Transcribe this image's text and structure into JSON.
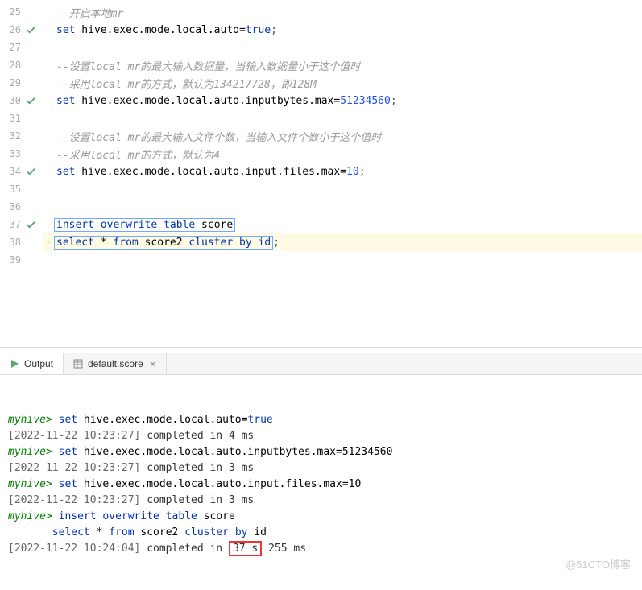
{
  "editor": {
    "lines": [
      {
        "n": 25,
        "mark": false,
        "fold": "",
        "segs": [
          [
            "cm",
            "--开启本地mr"
          ]
        ]
      },
      {
        "n": 26,
        "mark": true,
        "fold": "",
        "segs": [
          [
            "kw",
            "set"
          ],
          [
            "str",
            " hive.exec.mode.local.auto="
          ],
          [
            "kw",
            "true"
          ],
          [
            "punc",
            ";"
          ]
        ]
      },
      {
        "n": 27,
        "mark": false,
        "fold": "",
        "segs": []
      },
      {
        "n": 28,
        "mark": false,
        "fold": "",
        "segs": [
          [
            "cm",
            "--设置local mr的最大输入数据量，当输入数据量小于这个值时"
          ]
        ]
      },
      {
        "n": 29,
        "mark": false,
        "fold": "",
        "segs": [
          [
            "cm",
            "--采用local mr的方式，默认为134217728，即128M"
          ]
        ]
      },
      {
        "n": 30,
        "mark": true,
        "fold": "",
        "segs": [
          [
            "kw",
            "set"
          ],
          [
            "str",
            " hive.exec.mode.local.auto.inputbytes.max="
          ],
          [
            "num",
            "51234560"
          ],
          [
            "punc",
            ";"
          ]
        ]
      },
      {
        "n": 31,
        "mark": false,
        "fold": "",
        "segs": []
      },
      {
        "n": 32,
        "mark": false,
        "fold": "",
        "segs": [
          [
            "cm",
            "--设置local mr的最大输入文件个数，当输入文件个数小于这个值时"
          ]
        ]
      },
      {
        "n": 33,
        "mark": false,
        "fold": "",
        "segs": [
          [
            "cm",
            "--采用local mr的方式，默认为4"
          ]
        ]
      },
      {
        "n": 34,
        "mark": true,
        "fold": "",
        "segs": [
          [
            "kw",
            "set"
          ],
          [
            "str",
            " hive.exec.mode.local.auto.input.files.max="
          ],
          [
            "num",
            "10"
          ],
          [
            "punc",
            ";"
          ]
        ]
      },
      {
        "n": 35,
        "mark": false,
        "fold": "",
        "segs": []
      },
      {
        "n": 36,
        "mark": false,
        "fold": "",
        "segs": []
      },
      {
        "n": 37,
        "mark": true,
        "fold": "-",
        "box": true,
        "segs": [
          [
            "kw",
            "insert"
          ],
          [
            "str",
            " "
          ],
          [
            "kw",
            "overwrite"
          ],
          [
            "str",
            " "
          ],
          [
            "kw",
            "table"
          ],
          [
            "str",
            " score"
          ]
        ]
      },
      {
        "n": 38,
        "mark": false,
        "fold": "-",
        "box": true,
        "hl": true,
        "segs": [
          [
            "kw",
            "select"
          ],
          [
            "str",
            " * "
          ],
          [
            "kw",
            "from"
          ],
          [
            "str",
            " score2 "
          ],
          [
            "kw",
            "cluster"
          ],
          [
            "str",
            " "
          ],
          [
            "kw",
            "by"
          ],
          [
            "str",
            " "
          ],
          [
            "kw2",
            "id"
          ]
        ],
        "after": ";"
      },
      {
        "n": 39,
        "mark": false,
        "fold": "",
        "segs": []
      }
    ]
  },
  "tabs": {
    "output": "Output",
    "tab2": "default.score"
  },
  "console": {
    "prompt": "myhive>",
    "lines": [
      {
        "type": "cmd",
        "segs": [
          [
            "c-kw",
            "set"
          ],
          [
            "str",
            " hive.exec.mode.local.auto="
          ],
          [
            "c-kw",
            "true"
          ]
        ]
      },
      {
        "type": "res",
        "ts": "[2022-11-22 10:23:27]",
        "text": " completed in 4 ms"
      },
      {
        "type": "cmd",
        "segs": [
          [
            "c-kw",
            "set"
          ],
          [
            "str",
            " hive.exec.mode.local.auto.inputbytes.max=51234560"
          ]
        ]
      },
      {
        "type": "res",
        "ts": "[2022-11-22 10:23:27]",
        "text": " completed in 3 ms"
      },
      {
        "type": "cmd",
        "segs": [
          [
            "c-kw",
            "set"
          ],
          [
            "str",
            " hive.exec.mode.local.auto.input.files.max=10"
          ]
        ]
      },
      {
        "type": "res",
        "ts": "[2022-11-22 10:23:27]",
        "text": " completed in 3 ms"
      },
      {
        "type": "cmd",
        "segs": [
          [
            "c-kw",
            "insert"
          ],
          [
            "str",
            " "
          ],
          [
            "c-kw",
            "overwrite"
          ],
          [
            "str",
            " "
          ],
          [
            "c-kw",
            "table"
          ],
          [
            "str",
            " score"
          ]
        ]
      },
      {
        "type": "cont",
        "indent": "       ",
        "segs": [
          [
            "c-kw",
            "select"
          ],
          [
            "str",
            " * "
          ],
          [
            "c-kw",
            "from"
          ],
          [
            "str",
            " score2 "
          ],
          [
            "c-kw",
            "cluster"
          ],
          [
            "str",
            " "
          ],
          [
            "c-kw",
            "by"
          ],
          [
            "str",
            " id"
          ]
        ]
      },
      {
        "type": "res",
        "ts": "[2022-11-22 10:24:04]",
        "text": " completed in ",
        "boxed": "37 s",
        "after": " 255 ms"
      }
    ],
    "watermark": "@51CTO博客"
  }
}
